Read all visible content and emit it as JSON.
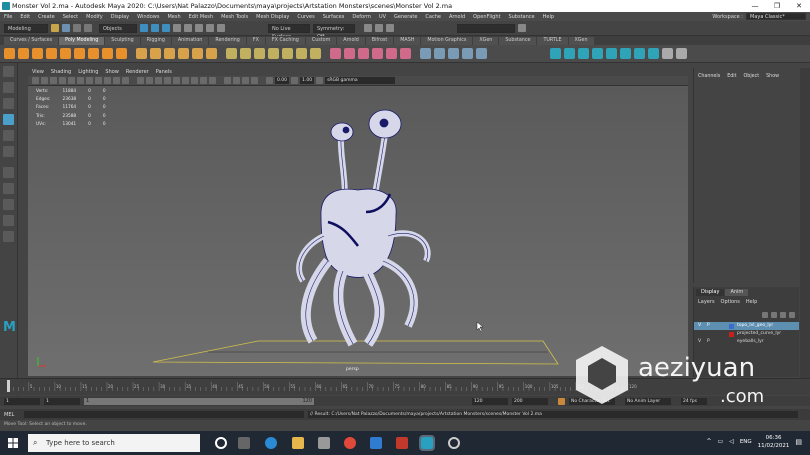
{
  "window": {
    "title": "Monster Vol 2.ma - Autodesk Maya 2020: C:\\Users\\Nat Palazzo\\Documents\\maya\\projects\\Artstation Monsters\\scenes\\Monster Vol 2.ma",
    "controls": [
      "—",
      "❐",
      "✕"
    ]
  },
  "menubar": {
    "items": [
      "File",
      "Edit",
      "Create",
      "Select",
      "Modify",
      "Display",
      "Windows",
      "Mesh",
      "Edit Mesh",
      "Mesh Tools",
      "Mesh Display",
      "Curves",
      "Surfaces",
      "Deform",
      "UV",
      "Generate",
      "Cache",
      "Arnold",
      "OpenFlight",
      "Substance",
      "Help"
    ],
    "workspace_label": "Workspace :",
    "workspace_value": "Maya Classic*"
  },
  "statusline": {
    "mode": "Modeling",
    "objects": "Objects",
    "live_surface": "No Live Surface",
    "symmetry": "Symmetry: Off"
  },
  "shelf_tabs": [
    "Curves / Surfaces",
    "Poly Modeling",
    "Sculpting",
    "Rigging",
    "Animation",
    "Rendering",
    "FX",
    "FX Caching",
    "Custom",
    "Arnold",
    "Bifrost",
    "MASH",
    "Motion Graphics",
    "XGen",
    "Substance",
    "TURTLE",
    "XGen"
  ],
  "shelf_active_tab": 1,
  "panel": {
    "menu": [
      "View",
      "Shading",
      "Lighting",
      "Show",
      "Renderer",
      "Panels"
    ],
    "field_a": "0.00",
    "field_b": "1.00",
    "color_space": "sRGB gamma"
  },
  "hud": {
    "rows": [
      {
        "label": "Verts:",
        "a": "11884",
        "b": "0",
        "c": "0"
      },
      {
        "label": "Edges:",
        "a": "23638",
        "b": "0",
        "c": "0"
      },
      {
        "label": "Faces:",
        "a": "11764",
        "b": "0",
        "c": "0"
      },
      {
        "label": "Tris:",
        "a": "23588",
        "b": "0",
        "c": "0"
      },
      {
        "label": "UVs:",
        "a": "13041",
        "b": "0",
        "c": "0"
      }
    ]
  },
  "camera_label": "persp",
  "channel_box": {
    "menu": [
      "Channels",
      "Edit",
      "Object",
      "Show"
    ]
  },
  "layers": {
    "tabs": [
      "Display",
      "Anim"
    ],
    "menu": [
      "Layers",
      "Options",
      "Help"
    ],
    "items": [
      {
        "name": "topo_lvl_geo_lyr",
        "color": "#3b6ccf",
        "selected": true,
        "v": "V",
        "p": "P"
      },
      {
        "name": "projected_curve_lyr",
        "color": "#c8201c",
        "selected": false,
        "v": "",
        "p": ""
      },
      {
        "name": "eyeballs_lyr",
        "color": "#3c3c3c",
        "selected": false,
        "v": "V",
        "p": "P"
      }
    ]
  },
  "timeline": {
    "ticks": [
      "5",
      "10",
      "15",
      "20",
      "25",
      "30",
      "35",
      "40",
      "45",
      "50",
      "55",
      "60",
      "65",
      "70",
      "75",
      "80",
      "85",
      "90",
      "95",
      "100",
      "105",
      "110",
      "115",
      "120"
    ]
  },
  "range": {
    "start": "1",
    "start_inner": "1",
    "mid": "1",
    "end_inner": "120",
    "end": "120",
    "end_outer": "200",
    "char_set": "No Character Set",
    "anim_layer": "No Anim Layer",
    "fps": "24 fps"
  },
  "cmdline": {
    "lang": "MEL",
    "result": "// Result: C:/Users/Nat Palazzo/Documents/maya/projects/Artstation Monsters/scenes/Monster Vol 2.ma"
  },
  "helpline": "Move Tool: Select an object to move.",
  "taskbar": {
    "search_placeholder": "Type here to search",
    "lang": "ENG",
    "time": "06:36",
    "date": "11/02/2021"
  },
  "watermark": {
    "text": "aeziyuan",
    "suffix": ".com"
  },
  "colors": {
    "accent": "#4aa0c8",
    "layer_sel": "#5d8fb1",
    "mesh_fill": "#d6d8ea",
    "mesh_wire": "#1a1a6a"
  }
}
